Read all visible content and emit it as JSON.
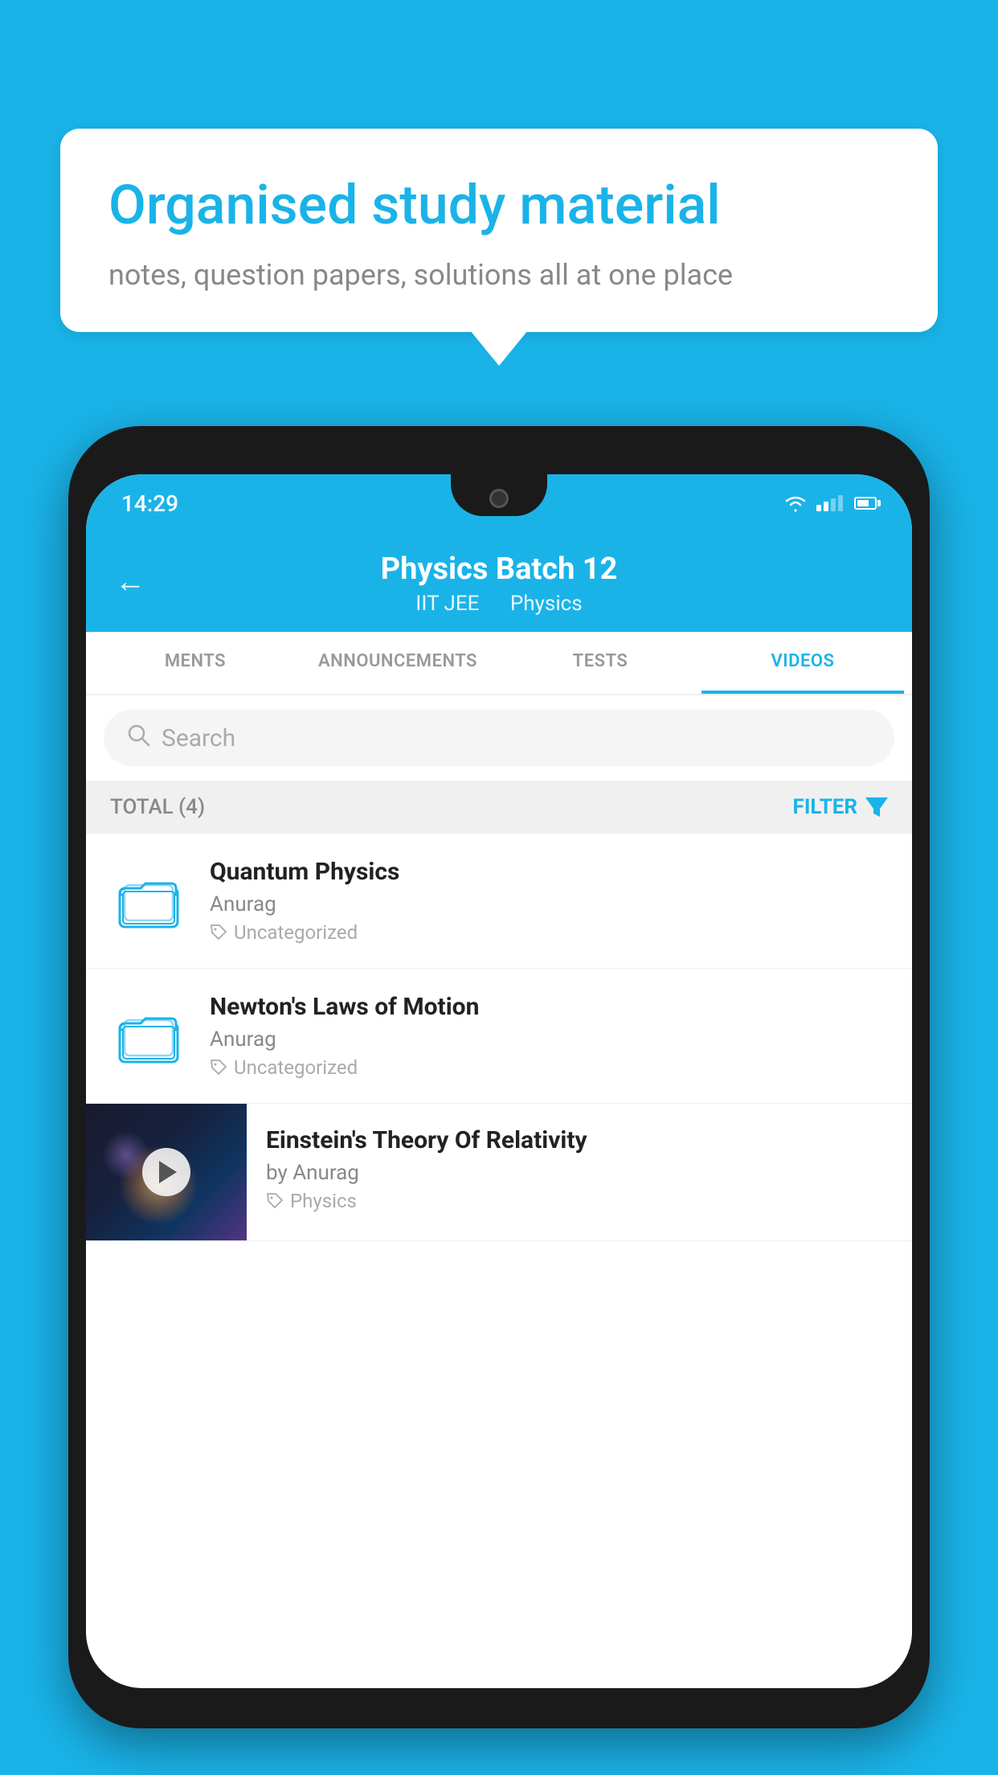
{
  "background_color": "#1ab3e8",
  "speech_bubble": {
    "title": "Organised study material",
    "subtitle": "notes, question papers, solutions all at one place"
  },
  "phone": {
    "status_bar": {
      "time": "14:29"
    },
    "header": {
      "back_label": "←",
      "title": "Physics Batch 12",
      "subtitle_part1": "IIT JEE",
      "subtitle_part2": "Physics"
    },
    "tabs": [
      {
        "label": "MENTS",
        "active": false
      },
      {
        "label": "ANNOUNCEMENTS",
        "active": false
      },
      {
        "label": "TESTS",
        "active": false
      },
      {
        "label": "VIDEOS",
        "active": true
      }
    ],
    "search": {
      "placeholder": "Search"
    },
    "filter_bar": {
      "total_label": "TOTAL (4)",
      "filter_label": "FILTER"
    },
    "videos": [
      {
        "title": "Quantum Physics",
        "author": "Anurag",
        "tag": "Uncategorized",
        "has_thumb": false
      },
      {
        "title": "Newton's Laws of Motion",
        "author": "Anurag",
        "tag": "Uncategorized",
        "has_thumb": false
      },
      {
        "title": "Einstein's Theory Of Relativity",
        "author": "by Anurag",
        "tag": "Physics",
        "has_thumb": true
      }
    ]
  }
}
